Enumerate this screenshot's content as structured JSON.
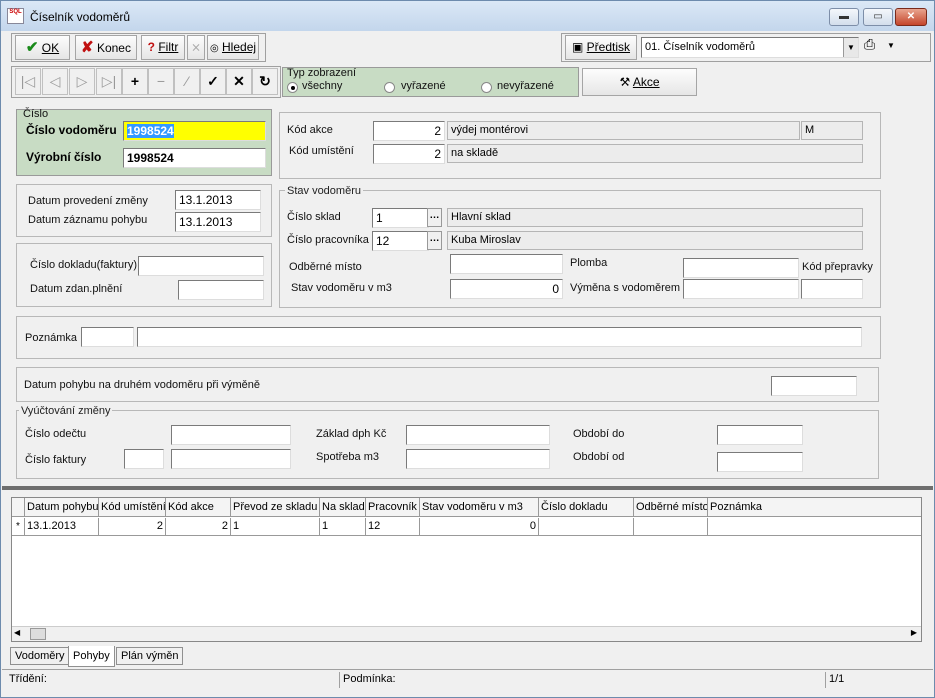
{
  "window": {
    "title": "Číselník vodoměrů",
    "icon_text": "SQL"
  },
  "toolbar": {
    "ok": "OK",
    "konec": "Konec",
    "filtr": "Filtr",
    "hledej": "Hledej",
    "predtisk": "Předtisk",
    "report_select": "01. Číselník vodoměrů",
    "akce": "Akce"
  },
  "typ_zobrazeni": {
    "label": "Typ zobrazení",
    "options": [
      "všechny",
      "vyřazené",
      "nevyřazené"
    ],
    "selected": "všechny"
  },
  "cislo_group": {
    "label": "Číslo",
    "cislo_vodomeru_label": "Číslo vodoměru",
    "cislo_vodomeru": "1998524",
    "vyrobni_cislo_label": "Výrobní číslo",
    "vyrobni_cislo": "1998524"
  },
  "akce_group": {
    "kod_akce_label": "Kód akce",
    "kod_akce": "2",
    "kod_akce_text": "výdej montérovi",
    "kod_akce_code": "M",
    "kod_umisteni_label": "Kód umístění",
    "kod_umisteni": "2",
    "kod_umisteni_text": "na skladě"
  },
  "datum_group": {
    "datum_provedeni_label": "Datum provedení změny",
    "datum_provedeni": "13.1.2013",
    "datum_zaznamu_label": "Datum záznamu pohybu",
    "datum_zaznamu": "13.1.2013"
  },
  "doklad_group": {
    "cislo_dokladu_label": "Číslo dokladu(faktury)",
    "cislo_dokladu": "",
    "datum_zdan_label": "Datum zdan.plnění",
    "datum_zdan": ""
  },
  "stav_group": {
    "label": "Stav vodoměru",
    "cislo_sklad_label": "Číslo sklad",
    "cislo_sklad": "1",
    "cislo_sklad_text": "Hlavní sklad",
    "cislo_prac_label": "Číslo pracovníka",
    "cislo_prac": "12",
    "cislo_prac_text": "Kuba Miroslav",
    "odberne_misto_label": "Odběrné místo",
    "odberne_misto": "",
    "plomba_label": "Plomba",
    "plomba": "",
    "kod_prepravky_label": "Kód přepravky",
    "kod_prepravky": "",
    "stav_label": "Stav vodoměru v m3",
    "stav": "0",
    "vymena_label": "Výměna s vodoměrem",
    "vymena": ""
  },
  "poznamka": {
    "label": "Poznámka",
    "code": "",
    "text": ""
  },
  "datum_pohybu_druhy": {
    "label": "Datum pohybu na druhém vodoměru při výměně",
    "value": ""
  },
  "vyuctovani": {
    "label": "Vyúčtování změny",
    "cislo_odectu_label": "Číslo odečtu",
    "cislo_odectu": "",
    "cislo_faktury_label": "Číslo faktury",
    "cislo_faktury_a": "",
    "cislo_faktury_b": "",
    "zaklad_label": "Základ dph Kč",
    "zaklad": "",
    "spotreba_label": "Spotřeba m3",
    "spotreba": "",
    "obdobi_do_label": "Období do",
    "obdobi_do": "",
    "obdobi_od_label": "Období od",
    "obdobi_od": ""
  },
  "grid": {
    "columns": [
      "Datum pohybu",
      "Kód umístění",
      "Kód akce",
      "Převod ze skladu",
      "Na sklad",
      "Pracovník",
      "Stav vodoměru v m3",
      "Číslo dokladu",
      "Odběrné místo",
      "Poznámka"
    ],
    "row_marker": "*",
    "rows": [
      [
        "13.1.2013",
        "2",
        "2",
        "1",
        "1",
        "12",
        "0",
        "",
        "",
        ""
      ]
    ]
  },
  "tabs": [
    "Vodoměry",
    "Pohyby",
    "Plán výměn"
  ],
  "active_tab": "Pohyby",
  "status": {
    "trideni": "Třídění:",
    "podminka": "Podmínka:",
    "pages": "1/1"
  }
}
